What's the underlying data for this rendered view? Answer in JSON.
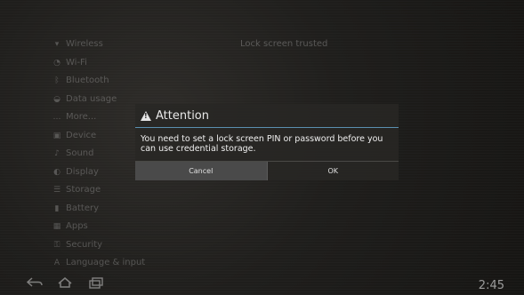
{
  "background": {
    "title": "Lock screen trusted",
    "settings_items": [
      {
        "icon": "wifi-icon",
        "glyph": "▾",
        "label": "Wireless"
      },
      {
        "icon": "data-icon",
        "glyph": "◔",
        "label": "Wi-Fi"
      },
      {
        "icon": "bluetooth-icon",
        "glyph": "ᛒ",
        "label": "Bluetooth"
      },
      {
        "icon": "usage-icon",
        "glyph": "◒",
        "label": "Data usage"
      },
      {
        "icon": "more-icon",
        "glyph": "…",
        "label": "More..."
      },
      {
        "icon": "device-icon",
        "glyph": "▣",
        "label": "Device"
      },
      {
        "icon": "sound-icon",
        "glyph": "♪",
        "label": "Sound"
      },
      {
        "icon": "display-icon",
        "glyph": "◐",
        "label": "Display"
      },
      {
        "icon": "storage-icon",
        "glyph": "☰",
        "label": "Storage"
      },
      {
        "icon": "battery-icon",
        "glyph": "▮",
        "label": "Battery"
      },
      {
        "icon": "apps-icon",
        "glyph": "▦",
        "label": "Apps"
      },
      {
        "icon": "security-icon",
        "glyph": "⚿",
        "label": "Security"
      },
      {
        "icon": "language-icon",
        "glyph": "A",
        "label": "Language & input"
      }
    ]
  },
  "dialog": {
    "title": "Attention",
    "message": "You need to set a lock screen PIN or password before you can use credential storage.",
    "cancel_label": "Cancel",
    "ok_label": "OK"
  },
  "status": {
    "time": "2:45"
  },
  "colors": {
    "accent": "#5a8fb0"
  }
}
